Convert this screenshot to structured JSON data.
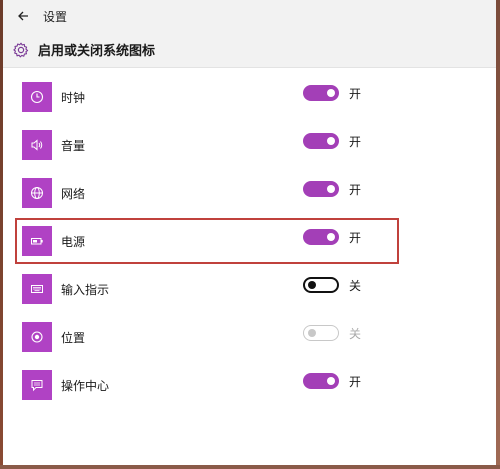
{
  "window": {
    "title": "设置"
  },
  "header": {
    "title": "启用或关闭系统图标"
  },
  "items": [
    {
      "icon": "clock-icon",
      "label": "时钟",
      "state": "开",
      "status": "on"
    },
    {
      "icon": "volume-icon",
      "label": "音量",
      "state": "开",
      "status": "on"
    },
    {
      "icon": "network-globe-icon",
      "label": "网络",
      "state": "开",
      "status": "on"
    },
    {
      "icon": "battery-power-icon",
      "label": "电源",
      "state": "开",
      "status": "on"
    },
    {
      "icon": "keyboard-icon",
      "label": "输入指示",
      "state": "关",
      "status": "off"
    },
    {
      "icon": "location-icon",
      "label": "位置",
      "state": "关",
      "status": "disabled"
    },
    {
      "icon": "action-center-icon",
      "label": "操作中心",
      "state": "开",
      "status": "on"
    }
  ],
  "colors": {
    "accent": "#b042c4",
    "toggle_on": "#a33fb7",
    "highlight": "#c0413c"
  }
}
